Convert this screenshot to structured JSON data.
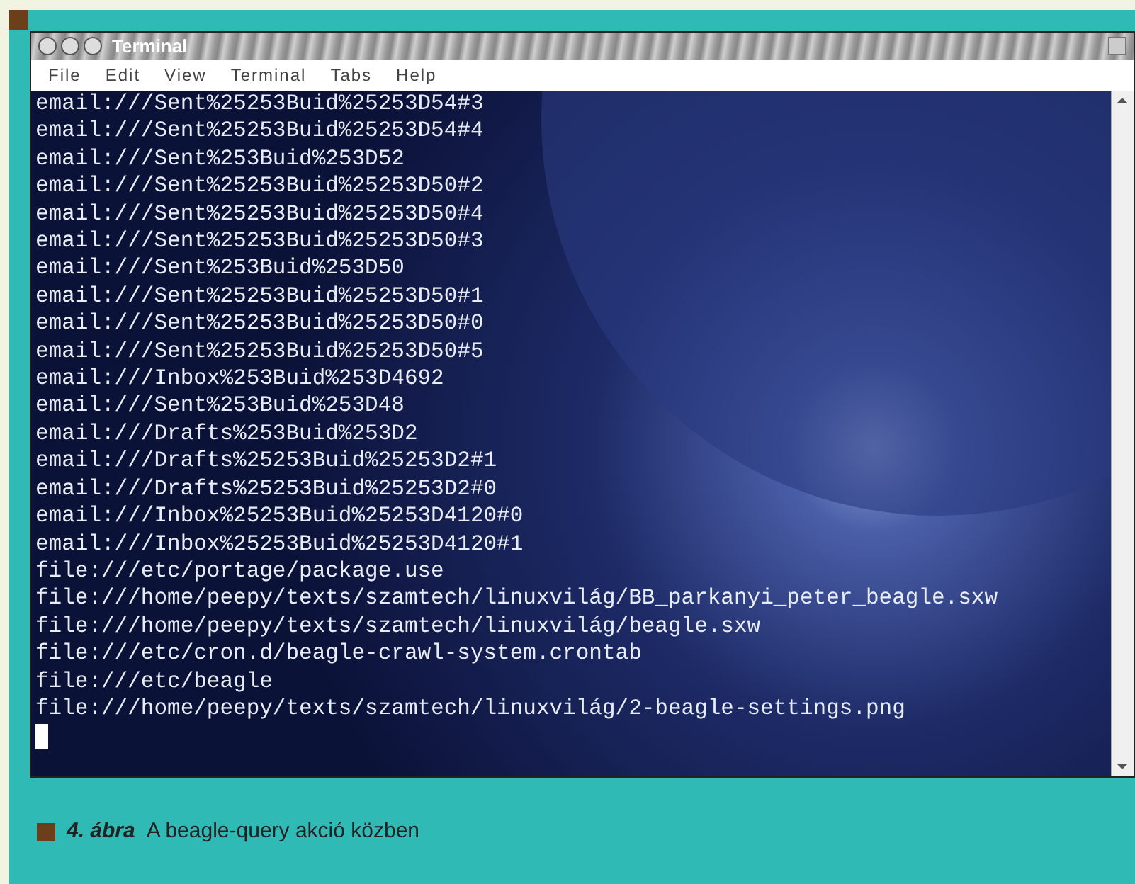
{
  "window": {
    "title": "Terminal"
  },
  "menu": [
    "File",
    "Edit",
    "View",
    "Terminal",
    "Tabs",
    "Help"
  ],
  "lines": [
    "email:///Sent%25253Buid%25253D54#3",
    "email:///Sent%25253Buid%25253D54#4",
    "email:///Sent%253Buid%253D52",
    "email:///Sent%25253Buid%25253D50#2",
    "email:///Sent%25253Buid%25253D50#4",
    "email:///Sent%25253Buid%25253D50#3",
    "email:///Sent%253Buid%253D50",
    "email:///Sent%25253Buid%25253D50#1",
    "email:///Sent%25253Buid%25253D50#0",
    "email:///Sent%25253Buid%25253D50#5",
    "email:///Inbox%253Buid%253D4692",
    "email:///Sent%253Buid%253D48",
    "email:///Drafts%253Buid%253D2",
    "email:///Drafts%25253Buid%25253D2#1",
    "email:///Drafts%25253Buid%25253D2#0",
    "email:///Inbox%25253Buid%25253D4120#0",
    "email:///Inbox%25253Buid%25253D4120#1",
    "file:///etc/portage/package.use",
    "file:///home/peepy/texts/szamtech/linuxvilág/BB_parkanyi_peter_beagle.sxw",
    "file:///home/peepy/texts/szamtech/linuxvilág/beagle.sxw",
    "file:///etc/cron.d/beagle-crawl-system.crontab",
    "file:///etc/beagle",
    "file:///home/peepy/texts/szamtech/linuxvilág/2-beagle-settings.png"
  ],
  "caption": {
    "label": "4. ábra",
    "text": "A beagle-query akció közben"
  }
}
